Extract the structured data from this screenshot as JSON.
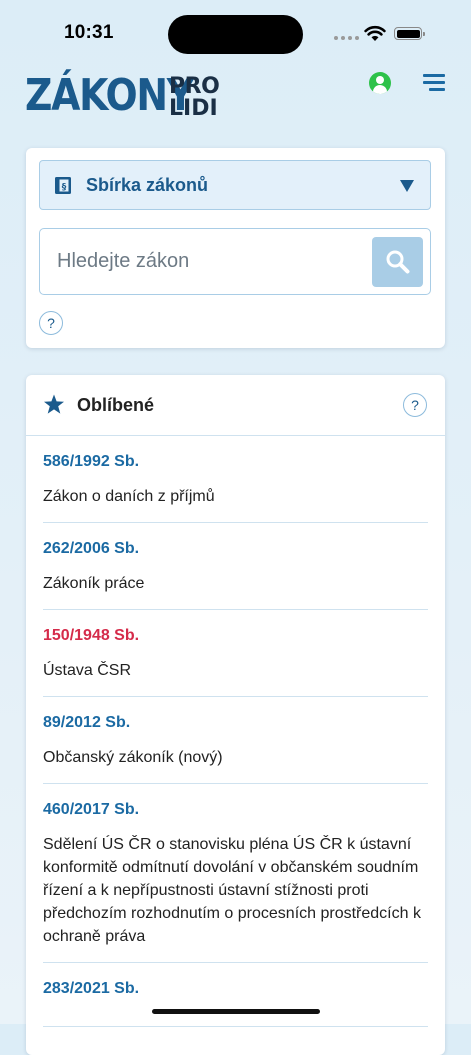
{
  "status_bar": {
    "time": "10:31"
  },
  "header": {
    "logo_main": "ZÁKONY",
    "logo_line1": "PRO",
    "logo_line2": "LIDI"
  },
  "search": {
    "collection_label": "Sbírka zákonů",
    "placeholder": "Hledejte zákon",
    "help_symbol": "?"
  },
  "favorites": {
    "title": "Oblíbené",
    "help_symbol": "?",
    "items": [
      {
        "number": "586/1992 Sb.",
        "name": "Zákon o daních z příjmů"
      },
      {
        "number": "262/2006 Sb.",
        "name": "Zákoník práce"
      },
      {
        "number": "150/1948 Sb.",
        "name": "Ústava ČSR"
      },
      {
        "number": "89/2012 Sb.",
        "name": "Občanský zákoník (nový)"
      },
      {
        "number": "460/2017 Sb.",
        "name": "Sdělení ÚS ČR o stanovisku pléna ÚS ČR k ústavní konformitě odmítnutí dovolání v občanském soudním řízení a k nepřípustnosti ústavní stížnosti proti předchozím rozhodnutím o procesních prostředcích k ochraně práva"
      },
      {
        "number": "283/2021 Sb.",
        "name": ""
      }
    ]
  },
  "colors": {
    "brand_blue": "#1b5a8c",
    "link_blue": "#1b6aa3",
    "repealed_red": "#d52b4a",
    "user_green": "#2ec24a"
  },
  "icons": [
    "wifi-icon",
    "battery-icon",
    "user-icon",
    "menu-icon",
    "book-icon",
    "caret-down-icon",
    "search-icon",
    "help-icon",
    "star-icon"
  ]
}
